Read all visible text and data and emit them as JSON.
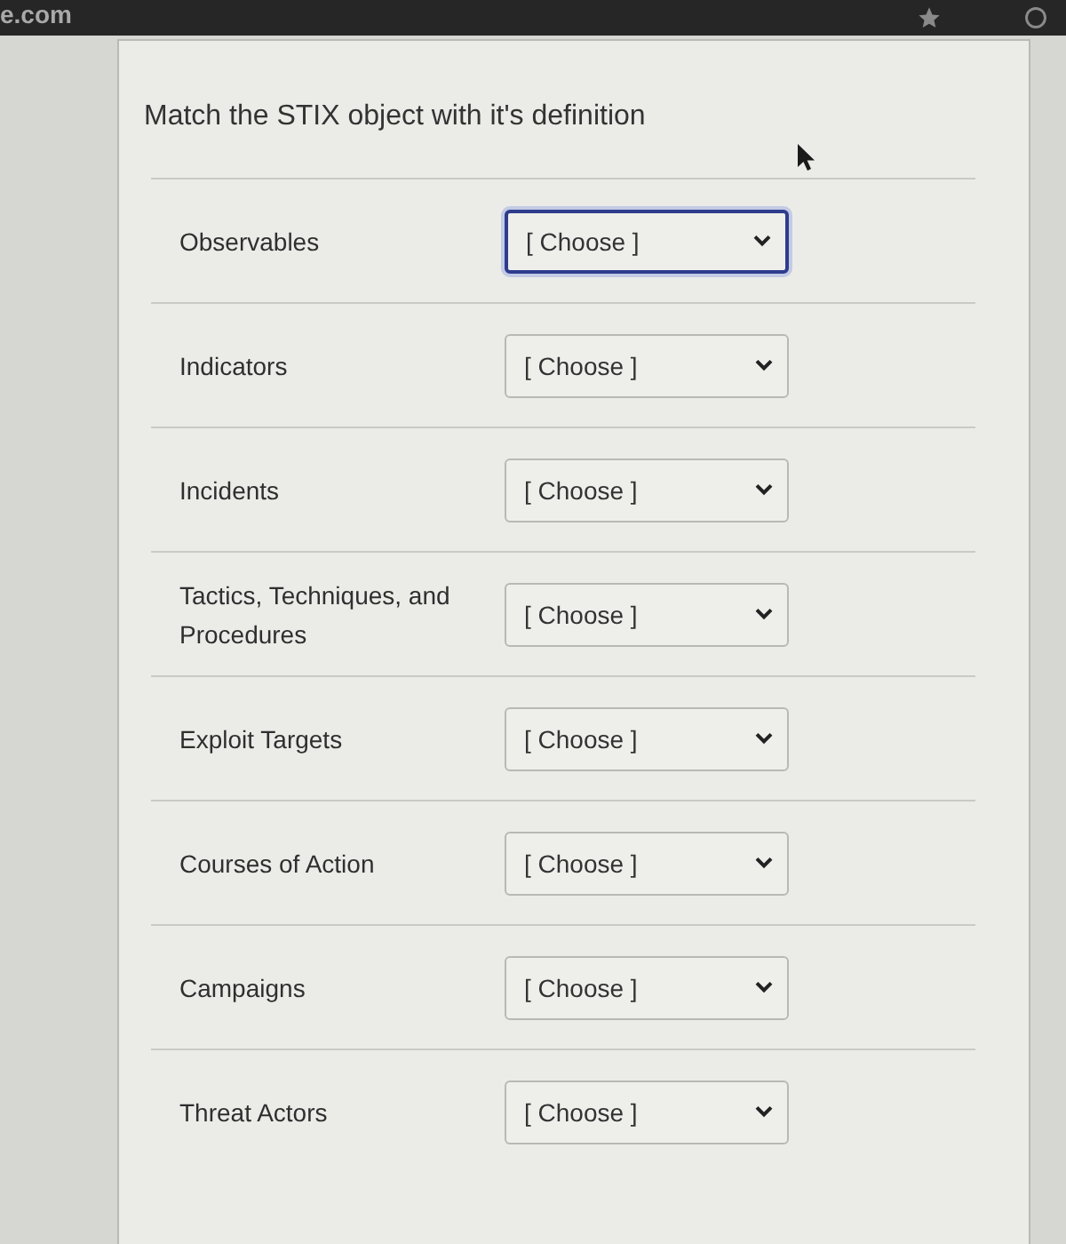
{
  "browser": {
    "url": "e.com"
  },
  "question": {
    "title": "Match the STIX object with it's definition"
  },
  "matches": [
    {
      "label": "Observables",
      "select": {
        "value": "[ Choose ]",
        "focused": true
      }
    },
    {
      "label": "Indicators",
      "select": {
        "value": "[ Choose ]",
        "focused": false
      }
    },
    {
      "label": "Incidents",
      "select": {
        "value": "[ Choose ]",
        "focused": false
      }
    },
    {
      "label": "Tactics, Techniques, and Procedures",
      "select": {
        "value": "[ Choose ]",
        "focused": false
      }
    },
    {
      "label": "Exploit Targets",
      "select": {
        "value": "[ Choose ]",
        "focused": false
      }
    },
    {
      "label": "Courses of Action",
      "select": {
        "value": "[ Choose ]",
        "focused": false
      }
    },
    {
      "label": "Campaigns",
      "select": {
        "value": "[ Choose ]",
        "focused": false
      }
    },
    {
      "label": "Threat Actors",
      "select": {
        "value": "[ Choose ]",
        "focused": false
      }
    }
  ]
}
